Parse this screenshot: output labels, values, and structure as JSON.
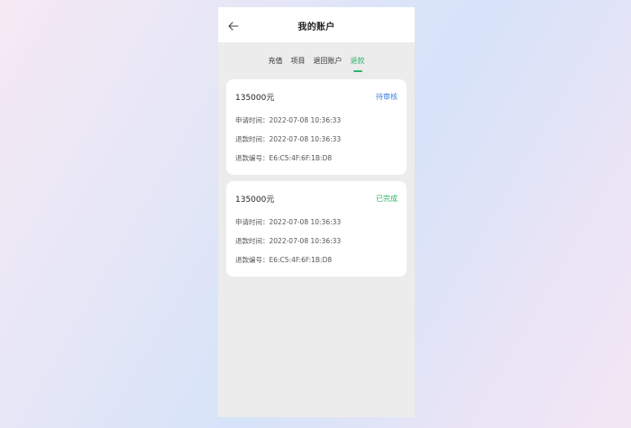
{
  "header": {
    "title": "我的账户",
    "back_icon": "arrow-left-icon"
  },
  "tabs": [
    {
      "label": "充值",
      "active": false
    },
    {
      "label": "项目",
      "active": false
    },
    {
      "label": "退回账户",
      "active": false
    },
    {
      "label": "退款",
      "active": true
    }
  ],
  "colors": {
    "accent_green": "#2fb36a",
    "pending_blue": "#3b82d9"
  },
  "records": [
    {
      "amount": "135000元",
      "status": "待审核",
      "apply_label": "申请时间：",
      "apply_time": "2022-07-08 10:36:33",
      "refund_label": "退款时间：",
      "refund_time": "2022-07-08 10:36:33",
      "number_label": "退款编号：",
      "number": "E6:C5:4F:6F:1B:D8"
    },
    {
      "amount": "135000元",
      "status": "已完成",
      "apply_label": "申请时间：",
      "apply_time": "2022-07-08 10:36:33",
      "refund_label": "退款时间：",
      "refund_time": "2022-07-08 10:36:33",
      "number_label": "退款编号：",
      "number": "E6:C5:4F:6F:1B:D8"
    }
  ]
}
